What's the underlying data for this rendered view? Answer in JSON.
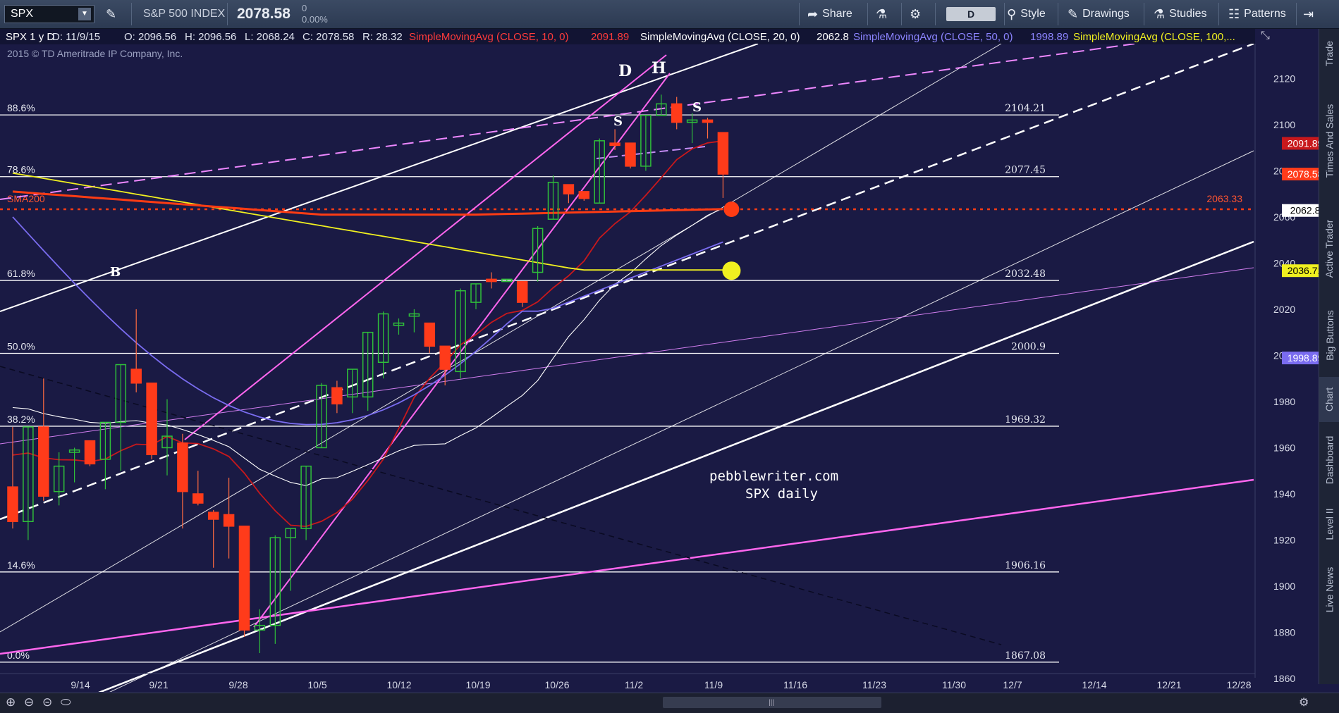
{
  "toolbar": {
    "symbol": "SPX",
    "instrument_name": "S&P 500 INDEX",
    "last_price": "2078.58",
    "change": "0",
    "change_pct": "0.00%",
    "share": "Share",
    "aggregation": "D",
    "style": "Style",
    "drawings": "Drawings",
    "studies": "Studies",
    "patterns": "Patterns"
  },
  "infobar": {
    "title": "SPX 1 y D",
    "date": "D: 11/9/15",
    "open": "O: 2096.56",
    "high": "H: 2096.56",
    "low": "L: 2068.24",
    "close": "C: 2078.58",
    "range": "R: 28.32",
    "sma10": "SimpleMovingAvg (CLOSE, 10, 0)",
    "sma10_val": "2091.89",
    "sma20": "SimpleMovingAvg (CLOSE, 20, 0)",
    "sma20_val": "2062.8",
    "sma50": "SimpleMovingAvg (CLOSE, 50, 0)",
    "sma50_val": "1998.89",
    "sma100": "SimpleMovingAvg (CLOSE, 100,..."
  },
  "copyright": "2015 © TD Ameritrade IP Company, Inc.",
  "watermark": {
    "line1": "pebblewriter.com",
    "line2": "SPX daily"
  },
  "side_tabs": [
    "Trade",
    "Times And Sales",
    "Active Trader",
    "Big Buttons",
    "Chart",
    "Dashboard",
    "Level II",
    "Live News"
  ],
  "colors": {
    "bg": "#1a1a44",
    "up": "#2fbf3a",
    "down": "#ff3b1a",
    "sma10": "#c8181c",
    "sma20": "#ffffff",
    "sma50": "#7a6cf0",
    "sma100": "#f0f020",
    "sma200": "#ff3c14",
    "fib": "#ffffff",
    "channel": "#ff66ee"
  },
  "chart_data": {
    "type": "candlestick",
    "title": "SPX 1 y D",
    "ylim": [
      1860,
      2130
    ],
    "yticks": [
      1860,
      1880,
      1900,
      1920,
      1940,
      1960,
      1980,
      2000,
      2020,
      2040,
      2060,
      2080,
      2100,
      2120
    ],
    "xticks": [
      "9/14",
      "9/21",
      "9/28",
      "10/5",
      "10/12",
      "10/19",
      "10/26",
      "11/2",
      "11/9",
      "11/16",
      "11/23",
      "11/30",
      "12/7",
      "12/14",
      "12/21",
      "12/28"
    ],
    "fib_levels": [
      {
        "pct": "88.6%",
        "price": "2104.21",
        "value": 2104.21
      },
      {
        "pct": "78.6%",
        "price": "2077.45",
        "value": 2077.45
      },
      {
        "pct": "61.8%",
        "price": "2032.48",
        "value": 2032.48
      },
      {
        "pct": "50.0%",
        "price": "2000.9",
        "value": 2000.9
      },
      {
        "pct": "38.2%",
        "price": "1969.32",
        "value": 1969.32
      },
      {
        "pct": "14.6%",
        "price": "1906.16",
        "value": 1906.16
      },
      {
        "pct": "0.0%",
        "price": "1867.08",
        "value": 1867.08
      }
    ],
    "sma200_label": "SMA200",
    "sma200_level": "2063.33",
    "price_badges": [
      {
        "text": "2091.89",
        "value": 2091.89,
        "color": "#c8181c",
        "fg": "#ffffff"
      },
      {
        "text": "2078.58",
        "value": 2078.58,
        "color": "#ff3b1a",
        "fg": "#ffffff"
      },
      {
        "text": "2062.8",
        "value": 2062.8,
        "color": "#ffffff",
        "fg": "#000000"
      },
      {
        "text": "2036.71",
        "value": 2036.71,
        "color": "#f0f020",
        "fg": "#000000"
      },
      {
        "text": "1998.89",
        "value": 1998.89,
        "color": "#7a6cf0",
        "fg": "#ffffff"
      }
    ],
    "annotations": [
      "B",
      "D",
      "H",
      "S",
      "S"
    ],
    "candles": [
      {
        "d": "9/9",
        "o": 1943,
        "h": 1969,
        "l": 1925,
        "c": 1928
      },
      {
        "d": "9/10",
        "o": 1928,
        "h": 1965,
        "l": 1920,
        "c": 1969
      },
      {
        "d": "9/11",
        "o": 1969,
        "h": 1990,
        "l": 1937,
        "c": 1939
      },
      {
        "d": "9/14",
        "o": 1941,
        "h": 1958,
        "l": 1935,
        "c": 1952
      },
      {
        "d": "9/15",
        "o": 1958,
        "h": 1960,
        "l": 1945,
        "c": 1959
      },
      {
        "d": "9/16",
        "o": 1963,
        "h": 1963,
        "l": 1952,
        "c": 1953
      },
      {
        "d": "9/17",
        "o": 1955,
        "h": 1970,
        "l": 1942,
        "c": 1971
      },
      {
        "d": "9/18",
        "o": 1971,
        "h": 1990,
        "l": 1950,
        "c": 1996
      },
      {
        "d": "9/21",
        "o": 1994,
        "h": 2020,
        "l": 1984,
        "c": 1988
      },
      {
        "d": "9/22",
        "o": 1988,
        "h": 1988,
        "l": 1955,
        "c": 1957
      },
      {
        "d": "9/23",
        "o": 1960,
        "h": 1981,
        "l": 1948,
        "c": 1965
      },
      {
        "d": "9/24",
        "o": 1962,
        "h": 1966,
        "l": 1925,
        "c": 1941
      },
      {
        "d": "9/25",
        "o": 1940,
        "h": 1950,
        "l": 1935,
        "c": 1936
      },
      {
        "d": "9/28",
        "o": 1932,
        "h": 1933,
        "l": 1908,
        "c": 1929
      },
      {
        "d": "9/29",
        "o": 1931,
        "h": 1947,
        "l": 1912,
        "c": 1926
      },
      {
        "d": "9/30",
        "o": 1926,
        "h": 1926,
        "l": 1878,
        "c": 1881
      },
      {
        "d": "10/1",
        "o": 1881,
        "h": 1890,
        "l": 1871,
        "c": 1883
      },
      {
        "d": "10/2",
        "o": 1883,
        "h": 1922,
        "l": 1875,
        "c": 1921
      },
      {
        "d": "10/5",
        "o": 1921,
        "h": 1925,
        "l": 1898,
        "c": 1925
      },
      {
        "d": "10/6",
        "o": 1925,
        "h": 1952,
        "l": 1920,
        "c": 1952
      },
      {
        "d": "10/7",
        "o": 1960,
        "h": 1988,
        "l": 1962,
        "c": 1987
      },
      {
        "d": "10/8",
        "o": 1986,
        "h": 1989,
        "l": 1975,
        "c": 1979
      },
      {
        "d": "10/9",
        "o": 1982,
        "h": 1993,
        "l": 1975,
        "c": 1994
      },
      {
        "d": "10/12",
        "o": 1982,
        "h": 2000,
        "l": 1976,
        "c": 2010
      },
      {
        "d": "10/13",
        "o": 1997,
        "h": 2019,
        "l": 1990,
        "c": 2018
      },
      {
        "d": "10/14",
        "o": 2013,
        "h": 2016,
        "l": 2009,
        "c": 2014
      },
      {
        "d": "10/15",
        "o": 2017,
        "h": 2020,
        "l": 2010,
        "c": 2018
      },
      {
        "d": "10/16",
        "o": 2014,
        "h": 2014,
        "l": 2001,
        "c": 2004
      },
      {
        "d": "10/19",
        "o": 2004,
        "h": 2002,
        "l": 1987,
        "c": 1994
      },
      {
        "d": "10/20",
        "o": 1993,
        "h": 2029,
        "l": 1990,
        "c": 2028
      },
      {
        "d": "10/21",
        "o": 2023,
        "h": 2031,
        "l": 2020,
        "c": 2031
      },
      {
        "d": "10/22",
        "o": 2033,
        "h": 2036,
        "l": 2029,
        "c": 2032
      },
      {
        "d": "10/23",
        "o": 2032,
        "h": 2030,
        "l": 2032,
        "c": 2033
      },
      {
        "d": "10/26",
        "o": 2032,
        "h": 2024,
        "l": 2021,
        "c": 2023
      },
      {
        "d": "10/27",
        "o": 2036,
        "h": 2056,
        "l": 2032,
        "c": 2055
      },
      {
        "d": "10/28",
        "o": 2059,
        "h": 2078,
        "l": 2059,
        "c": 2075
      },
      {
        "d": "10/29",
        "o": 2074,
        "h": 2073,
        "l": 2066,
        "c": 2070
      },
      {
        "d": "10/30",
        "o": 2071,
        "h": 2070,
        "l": 2067,
        "c": 2068
      },
      {
        "d": "11/2",
        "o": 2066,
        "h": 2094,
        "l": 2066,
        "c": 2093
      },
      {
        "d": "11/3",
        "o": 2092,
        "h": 2098,
        "l": 2089,
        "c": 2091
      },
      {
        "d": "11/4",
        "o": 2092,
        "h": 2082,
        "l": 2081,
        "c": 2082
      },
      {
        "d": "11/5",
        "o": 2082,
        "h": 2104,
        "l": 2080,
        "c": 2104
      },
      {
        "d": "11/6",
        "o": 2104,
        "h": 2113,
        "l": 2104,
        "c": 2109
      },
      {
        "d": "11/9",
        "o": 2109,
        "h": 2112,
        "l": 2098,
        "c": 2101
      },
      {
        "d": "11/10",
        "o": 2101,
        "h": 2105,
        "l": 2092,
        "c": 2102
      },
      {
        "d": "11/11",
        "o": 2102,
        "h": 2103,
        "l": 2094,
        "c": 2101
      },
      {
        "d": "11/12",
        "o": 2096.56,
        "h": 2096.56,
        "l": 2068.24,
        "c": 2078.58
      }
    ]
  }
}
